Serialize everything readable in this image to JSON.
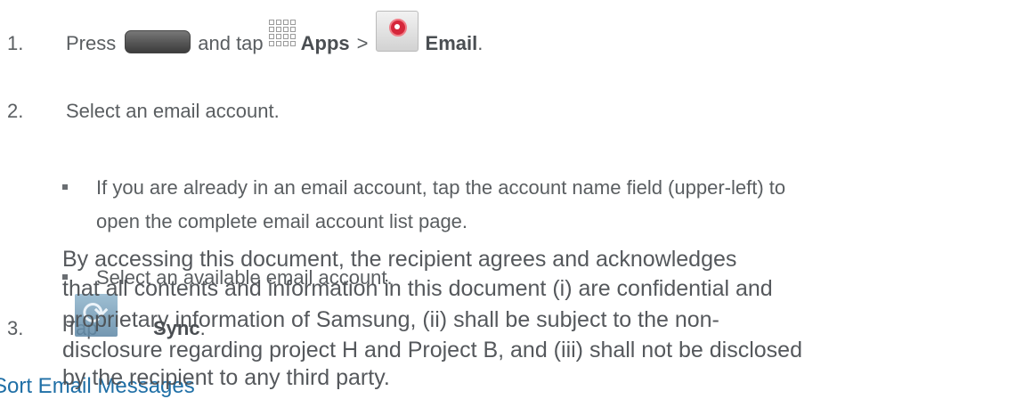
{
  "steps": [
    {
      "number": "1.",
      "prefix": "Press",
      "middle": "and tap",
      "apps": "Apps",
      "separator": ">",
      "email": "Email",
      "end": "."
    },
    {
      "number": "2.",
      "text": "Select an email account."
    },
    {
      "number": "3.",
      "prefix": "Tap",
      "label": "Sync",
      "end": "."
    }
  ],
  "bullets": [
    {
      "line1": "If you are already in an email account, tap the account name field (upper-left) to",
      "line2": "open the complete email account list page."
    },
    {
      "line1": "Select an available email account."
    }
  ],
  "section_heading": "Sort Email Messages",
  "watermark": [
    "By accessing this document, the recipient agrees and acknowledges",
    "that all contents and information in this document (i) are confidential and",
    "proprietary information of Samsung, (ii) shall be subject to the non-",
    "disclosure regarding project H and Project B, and (iii) shall not be disclosed",
    "by the recipient to any third party."
  ],
  "icons": [
    "home-button-icon",
    "apps-grid-icon",
    "email-app-icon",
    "sync-icon"
  ],
  "colors": {
    "text": "#5a5e61",
    "heading": "#1f6fa6",
    "email_red": "#d5263a"
  }
}
